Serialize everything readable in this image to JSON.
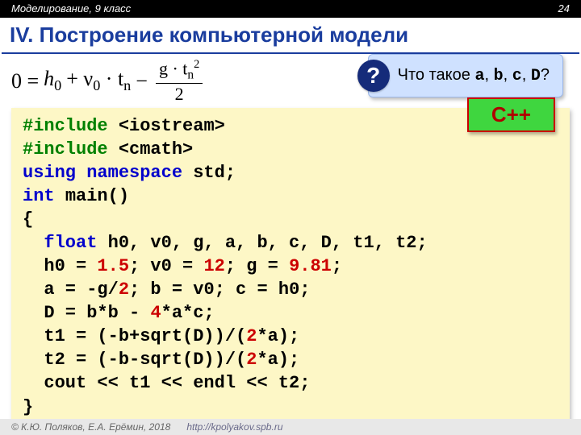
{
  "topbar": {
    "subject": "Моделирование, 9 класс",
    "page": "24"
  },
  "title": "IV. Построение компьютерной модели",
  "formula": {
    "lhs": "0 = ",
    "h0": "h",
    "h0_sub": "0",
    "plus1": " + ν",
    "v_sub": "0",
    "dot_t": " · t",
    "t_sub1": "n",
    "minus": " − ",
    "frac_num_a": "g · t",
    "frac_num_sub": "n",
    "frac_num_sup": "2",
    "frac_den": "2"
  },
  "callout": {
    "badge": "?",
    "prefix": "Что такое ",
    "vars": [
      "a",
      "b",
      "c",
      "D"
    ],
    "suffix": "?"
  },
  "cpp_tag": "C++",
  "code": {
    "l1a": "#include ",
    "l1b": "<iostream>",
    "l2a": "#include ",
    "l2b": "<cmath>",
    "l3a": "using namespace ",
    "l3b": "std;",
    "l4a": "int ",
    "l4b": "main()",
    "l5": "{",
    "l6a": "  ",
    "l6b": "float ",
    "l6c": "h0, v0, g, a, b, c, D, t1, t2;",
    "l7a": "  h0 = ",
    "l7b": "1.5",
    "l7c": "; v0 = ",
    "l7d": "12",
    "l7e": "; g = ",
    "l7f": "9.81",
    "l7g": ";",
    "l8a": "  a = -g/",
    "l8b": "2",
    "l8c": "; b = v0; c = h0;",
    "l9a": "  D = b*b - ",
    "l9b": "4",
    "l9c": "*a*c;",
    "l10a": "  t1 = (-b+sqrt(D))/(",
    "l10b": "2",
    "l10c": "*a);",
    "l11a": "  t2 = (-b-sqrt(D))/(",
    "l11b": "2",
    "l11c": "*a);",
    "l12": "  cout << t1 << endl << t2;",
    "l13": "}"
  },
  "footer": {
    "copyright": "© К.Ю. Поляков, Е.А. Ерёмин, 2018",
    "url": "http://kpolyakov.spb.ru"
  }
}
